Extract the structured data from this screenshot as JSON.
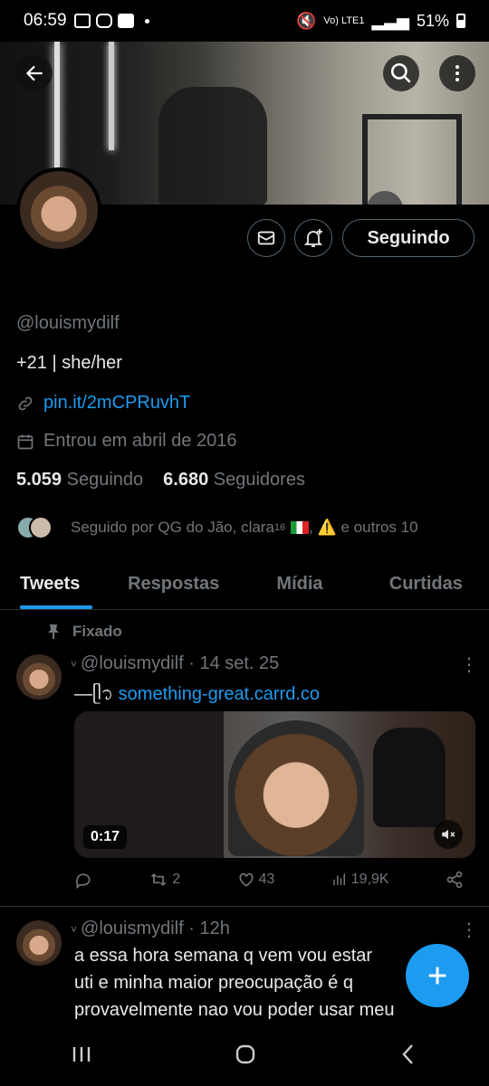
{
  "status_bar": {
    "time": "06:59",
    "network": "Vo) LTE1",
    "battery": "51%"
  },
  "profile": {
    "follow_button": "Seguindo",
    "handle": "@louismydilf",
    "bio": "+21 | she/her",
    "link": "pin.it/2mCPRuvhT",
    "joined": "Entrou em abril de 2016",
    "following_count": "5.059",
    "following_label": "Seguindo",
    "followers_count": "6.680",
    "followers_label": "Seguidores",
    "followed_by": "Seguido por QG do Jão, clara",
    "followed_by_sup": "16",
    "followed_by_more": ", ⚠️ e outros 10"
  },
  "tabs": [
    {
      "label": "Tweets"
    },
    {
      "label": "Respostas"
    },
    {
      "label": "Mídia"
    },
    {
      "label": "Curtidas"
    }
  ],
  "tweets": [
    {
      "pinned_label": "Fixado",
      "header": "@louismydilf · 14 set. 25",
      "text_prefix": "—ᥫ᭡ ",
      "link": "something-great.carrd.co",
      "media_duration": "0:17",
      "retweets": "2",
      "likes": "43",
      "views": "19,9K"
    },
    {
      "header": "@louismydilf · 12h",
      "line1": "a essa hora semana q vem vou estar",
      "line2": "uti e minha maior preocupação é q",
      "line3": "provavelmente nao vou poder usar meu"
    }
  ],
  "colors": {
    "accent": "#1d9bf0",
    "background": "#000000",
    "secondary_text": "#71767b",
    "divider": "#2f3336"
  }
}
